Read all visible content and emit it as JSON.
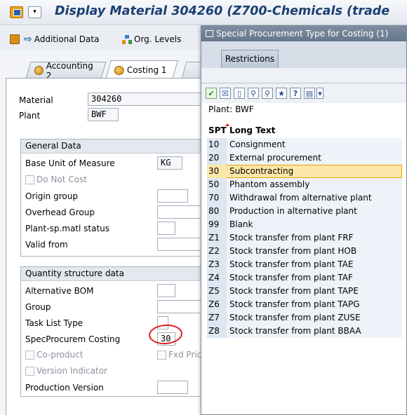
{
  "window": {
    "title": "Display Material 304260 (Z700-Chemicals (trade"
  },
  "toolbar": {
    "additional_data": "Additional Data",
    "org_levels": "Org. Levels"
  },
  "tabs": [
    {
      "label": "Accounting 2"
    },
    {
      "label": "Costing 1"
    }
  ],
  "header_fields": {
    "material_label": "Material",
    "material_value": "304260",
    "plant_label": "Plant",
    "plant_value": "BWF"
  },
  "general_data": {
    "title": "General Data",
    "base_uom_label": "Base Unit of Measure",
    "base_uom_value": "KG",
    "do_not_cost_label": "Do Not Cost",
    "origin_group_label": "Origin group",
    "overhead_group_label": "Overhead Group",
    "plant_status_label": "Plant-sp.matl status",
    "valid_from_label": "Valid from"
  },
  "quantity_structure": {
    "title": "Quantity structure data",
    "alt_bom_label": "Alternative BOM",
    "group_label": "Group",
    "task_list_type_label": "Task List Type",
    "spec_procurem_label": "SpecProcurem Costing",
    "spec_procurem_value": "30",
    "co_product_label": "Co-product",
    "fxd_price_label": "Fxd Price",
    "version_indicator_label": "Version Indicator",
    "production_version_label": "Production Version"
  },
  "popup": {
    "title": "Special Procurement Type for Costing (1)",
    "tab_label": "Restrictions",
    "plant_line": "Plant: BWF",
    "columns": {
      "spt": "SPT",
      "long_text": "Long Text"
    },
    "rows": [
      {
        "spt": "10",
        "text": "Consignment"
      },
      {
        "spt": "20",
        "text": "External procurement"
      },
      {
        "spt": "30",
        "text": "Subcontracting"
      },
      {
        "spt": "50",
        "text": "Phantom assembly"
      },
      {
        "spt": "70",
        "text": "Withdrawal from alternative plant"
      },
      {
        "spt": "80",
        "text": "Production in alternative plant"
      },
      {
        "spt": "99",
        "text": "Blank"
      },
      {
        "spt": "Z1",
        "text": "Stock transfer from plant FRF"
      },
      {
        "spt": "Z2",
        "text": "Stock transfer from plant HOB"
      },
      {
        "spt": "Z3",
        "text": "Stock transfer from plant TAE"
      },
      {
        "spt": "Z4",
        "text": "Stock transfer from plant TAF"
      },
      {
        "spt": "Z5",
        "text": "Stock transfer from plant TAPE"
      },
      {
        "spt": "Z6",
        "text": "Stock transfer from plant TAPG"
      },
      {
        "spt": "Z7",
        "text": "Stock transfer from plant ZUSE"
      },
      {
        "spt": "Z8",
        "text": "Stock transfer from plant BBAA"
      }
    ]
  },
  "colors": {
    "title_text": "#1b3f72",
    "selected_row": "#fde7a8",
    "annotation": "#e0201e"
  }
}
